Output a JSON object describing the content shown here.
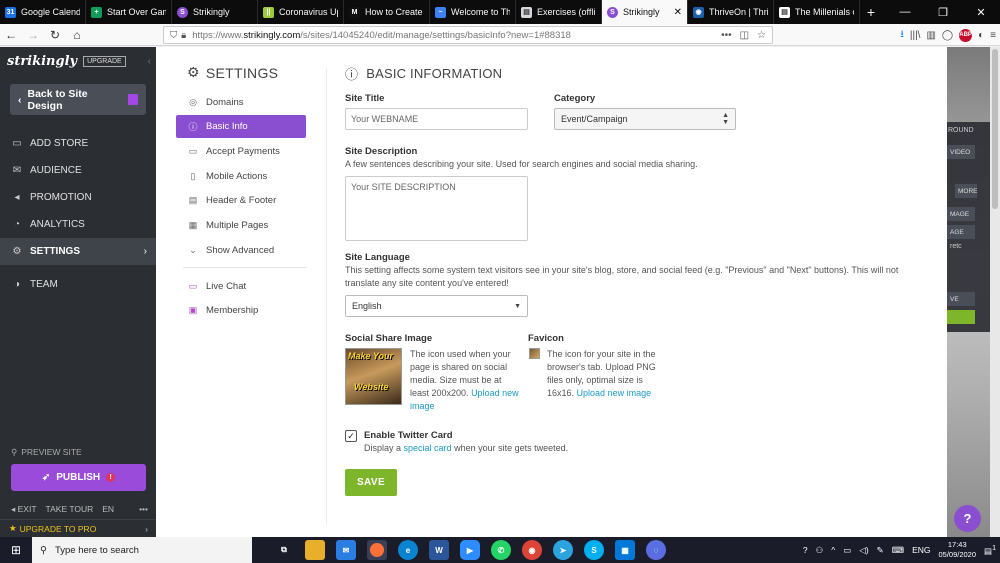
{
  "browser": {
    "tabs": [
      {
        "label": "Google Calendar",
        "icon": "google-calendar-icon",
        "color": "#1a73e8"
      },
      {
        "label": "Start Over Game",
        "icon": "sheets-icon",
        "color": "#0f9d58"
      },
      {
        "label": "Strikingly",
        "icon": "strikingly-icon",
        "color": "#8a4fd0"
      },
      {
        "label": "Coronavirus Upd",
        "icon": "doc-icon",
        "color": "#9ccc3c"
      },
      {
        "label": "How to Create M",
        "icon": "medium-icon",
        "color": "#111111"
      },
      {
        "label": "Welcome to The",
        "icon": "bird-icon",
        "color": "#3b82f6"
      },
      {
        "label": "Exercises (offline",
        "icon": "doc-icon",
        "color": "#d7d7db"
      },
      {
        "label": "Strikingly",
        "icon": "strikingly-icon",
        "color": "#8a4fd0",
        "active": true
      },
      {
        "label": "ThriveOn | Thrive",
        "icon": "globe-icon",
        "color": "#1d5fa8"
      },
      {
        "label": "The Millenials on",
        "icon": "doc-icon",
        "color": "#ffffff"
      }
    ],
    "new_tab": "+",
    "window_controls": [
      "—",
      "❐",
      "✕"
    ],
    "url_prefix": "https://www.",
    "url_host": "strikingly.com",
    "url_path": "/s/sites/14045240/edit/manage/settings/basicInfo?new=1#88318",
    "url_actions": "•••",
    "abp_label": "ABP"
  },
  "sidebar": {
    "logo": "strikingly",
    "upgrade_badge": "UPGRADE",
    "back_button": "Back to Site Design",
    "items": [
      {
        "label": "ADD STORE",
        "icon": "store-icon"
      },
      {
        "label": "AUDIENCE",
        "icon": "audience-icon"
      },
      {
        "label": "PROMOTION",
        "icon": "megaphone-icon"
      },
      {
        "label": "ANALYTICS",
        "icon": "analytics-icon"
      },
      {
        "label": "SETTINGS",
        "icon": "gear-icon",
        "active": true
      },
      {
        "label": "TEAM",
        "icon": "team-icon"
      }
    ],
    "preview_site": "PREVIEW SITE",
    "publish": "PUBLISH",
    "publish_alert": "!",
    "bottom_links": {
      "exit": "EXIT",
      "take_tour": "TAKE TOUR",
      "lang": "EN",
      "more": "•••"
    },
    "upgrade_pro": "UPGRADE TO PRO"
  },
  "settings_nav": {
    "title": "SETTINGS",
    "items": [
      {
        "label": "Domains",
        "icon": "globe-icon"
      },
      {
        "label": "Basic Info",
        "icon": "info-icon",
        "active": true
      },
      {
        "label": "Accept Payments",
        "icon": "card-icon"
      },
      {
        "label": "Mobile Actions",
        "icon": "mobile-icon"
      },
      {
        "label": "Header & Footer",
        "icon": "header-icon"
      },
      {
        "label": "Multiple Pages",
        "icon": "pages-icon"
      },
      {
        "label": "Show Advanced",
        "icon": "chevron-down-icon"
      }
    ],
    "extras": [
      {
        "label": "Live Chat",
        "icon": "chat-icon"
      },
      {
        "label": "Membership",
        "icon": "membership-icon"
      }
    ]
  },
  "basic_info": {
    "title": "BASIC INFORMATION",
    "site_title_label": "Site Title",
    "site_title_value": "Your WEBNAME",
    "category_label": "Category",
    "category_value": "Event/Campaign",
    "description_label": "Site Description",
    "description_help": "A few sentences describing your site. Used for search engines and social media sharing.",
    "description_value": "Your SITE DESCRIPTION",
    "language_label": "Site Language",
    "language_help": "This setting affects some system text visitors see in your site's blog, store, and social feed (e.g. \"Previous\" and \"Next\" buttons). This will not translate any site content you've entered!",
    "language_value": "English",
    "share_image_label": "Social Share Image",
    "share_image_help_1": "The icon used when your",
    "share_image_help_2": "page is shared on social",
    "share_image_help_3": "media. Size must be at",
    "share_image_help_4": "least 200x200.",
    "share_upload_link_1": "Upload new",
    "share_upload_link_2": "image",
    "share_thumb_text_1": "Make Your",
    "share_thumb_text_2": "Website",
    "favicon_label": "Favicon",
    "favicon_help_1": "The icon for your site in the",
    "favicon_help_2": "browser's tab. Upload PNG",
    "favicon_help_3": "files only, optimal size is",
    "favicon_help_4": "16x16.",
    "favicon_upload_link": "Upload new image",
    "twitter_label": "Enable Twitter Card",
    "twitter_checked": true,
    "twitter_help_pre": "Display a",
    "twitter_help_link": "special card",
    "twitter_help_post": "when your site gets tweeted.",
    "save_button": "SAVE"
  },
  "peek": {
    "labels": [
      "ROUND",
      "VIDEO",
      "MORE",
      "MAGE",
      "AGE",
      "retc",
      "VE"
    ],
    "help_bubble": "?"
  },
  "taskbar": {
    "search_placeholder": "Type here to search",
    "apps": [
      {
        "icon": "task-view-icon",
        "color": "#1a1c2a"
      },
      {
        "icon": "file-explorer-icon",
        "color": "#e8b02a"
      },
      {
        "icon": "mail-icon",
        "color": "#2a7de1"
      },
      {
        "icon": "firefox-icon",
        "color": "#ff7139"
      },
      {
        "icon": "edge-icon",
        "color": "#0a84d0"
      },
      {
        "icon": "word-icon",
        "color": "#2b579a"
      },
      {
        "icon": "zoom-icon",
        "color": "#2d8cff"
      },
      {
        "icon": "whatsapp-icon",
        "color": "#25d366"
      },
      {
        "icon": "chrome-icon",
        "color": "#db4437"
      },
      {
        "icon": "telegram-icon",
        "color": "#2aa3df"
      },
      {
        "icon": "skype-icon",
        "color": "#00aff0"
      },
      {
        "icon": "store-icon",
        "color": "#0078d7"
      },
      {
        "icon": "chat-icon",
        "color": "#5b6ee1"
      }
    ],
    "lang": "ENG",
    "time": "17:43",
    "date": "05/09/2020",
    "notifications": "1"
  }
}
